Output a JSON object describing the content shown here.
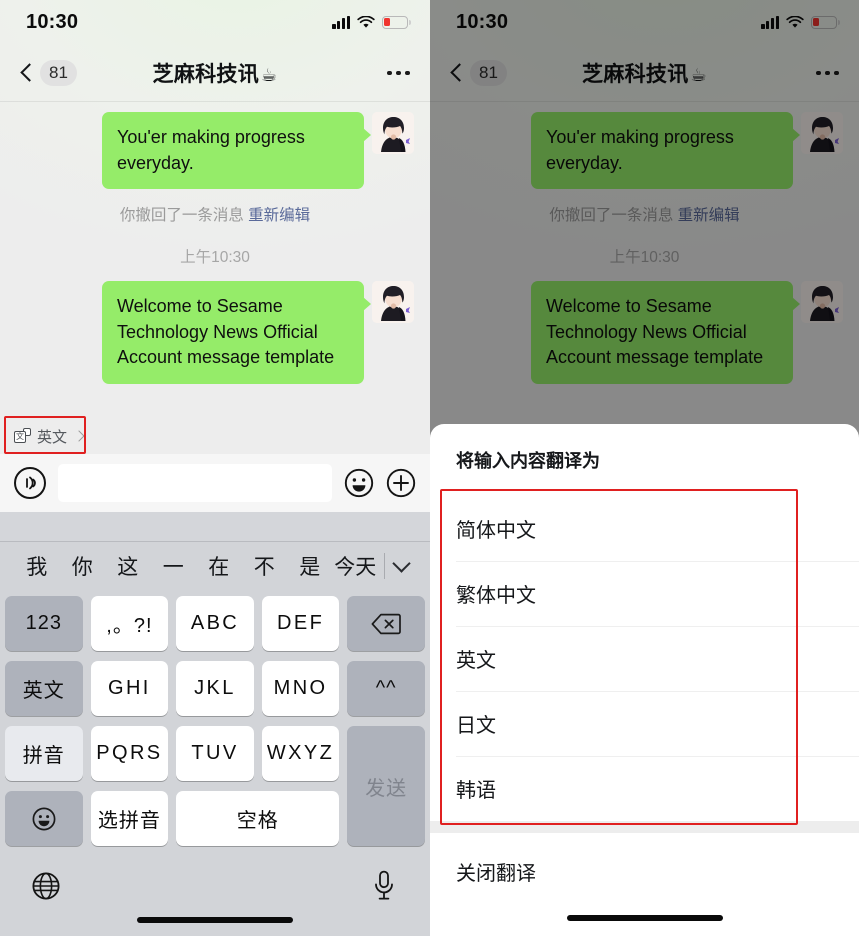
{
  "status_bar": {
    "time": "10:30",
    "signal_icon": "signal-bars-icon",
    "wifi_icon": "wifi-icon",
    "battery_icon": "battery-low-icon"
  },
  "nav": {
    "back_icon": "chevron-left-icon",
    "unread_count": "81",
    "title": "芝麻科技讯",
    "title_emoji": "☕",
    "more_icon": "more-dots-icon"
  },
  "chat": {
    "messages": [
      {
        "text": "You'er making progress everyday.",
        "side": "right"
      },
      {
        "text": "Welcome to Sesame Technology News Official Account message template",
        "side": "right"
      }
    ],
    "recall_notice": "你撤回了一条消息",
    "recall_action": "重新编辑",
    "timestamp": "上午10:30",
    "bubble_color": "#95ec69"
  },
  "translate_chip": {
    "label": "英文",
    "icon": "translate-icon",
    "chevron": "chevron-right-icon"
  },
  "input_bar": {
    "voice_icon": "voice-input-icon",
    "field_value": "",
    "field_placeholder": "",
    "emoji_icon": "emoji-smiley-icon",
    "more_icon": "plus-circle-icon"
  },
  "keyboard": {
    "suggestions": [
      "我",
      "你",
      "这",
      "一",
      "在",
      "不",
      "是",
      "今天"
    ],
    "expand_icon": "chevron-down-icon",
    "rows": [
      [
        {
          "label": "123",
          "style": "fn",
          "name": "key-123"
        },
        {
          "label": ",。?!",
          "style": "white",
          "name": "key-punctuation"
        },
        {
          "label": "ABC",
          "style": "white",
          "name": "key-abc"
        },
        {
          "label": "DEF",
          "style": "white",
          "name": "key-def"
        },
        {
          "label": "",
          "style": "fn",
          "name": "key-backspace",
          "icon": "backspace-icon"
        }
      ],
      [
        {
          "label": "英文",
          "style": "fn",
          "name": "key-english"
        },
        {
          "label": "GHI",
          "style": "white",
          "name": "key-ghi"
        },
        {
          "label": "JKL",
          "style": "white",
          "name": "key-jkl"
        },
        {
          "label": "MNO",
          "style": "white",
          "name": "key-mno"
        },
        {
          "label": "^^",
          "style": "fn",
          "name": "key-kaomoji"
        }
      ],
      [
        {
          "label": "拼音",
          "style": "fn-light",
          "name": "key-pinyin"
        },
        {
          "label": "PQRS",
          "style": "white",
          "name": "key-pqrs"
        },
        {
          "label": "TUV",
          "style": "white",
          "name": "key-tuv"
        },
        {
          "label": "WXYZ",
          "style": "white",
          "name": "key-wxyz"
        },
        {
          "label": "发送",
          "style": "send",
          "name": "key-send"
        }
      ],
      [
        {
          "label": "",
          "style": "fn",
          "name": "key-emoji",
          "icon": "emoji-smiley-icon"
        },
        {
          "label": "选拼音",
          "style": "white",
          "name": "key-select-pinyin"
        },
        {
          "label": "空格",
          "style": "wide",
          "name": "key-space"
        }
      ]
    ],
    "globe_icon": "globe-icon",
    "mic_icon": "microphone-icon"
  },
  "sheet": {
    "title": "将输入内容翻译为",
    "options": [
      "简体中文",
      "繁体中文",
      "英文",
      "日文",
      "韩语"
    ],
    "close_label": "关闭翻译"
  },
  "highlight_color": "#e02020"
}
